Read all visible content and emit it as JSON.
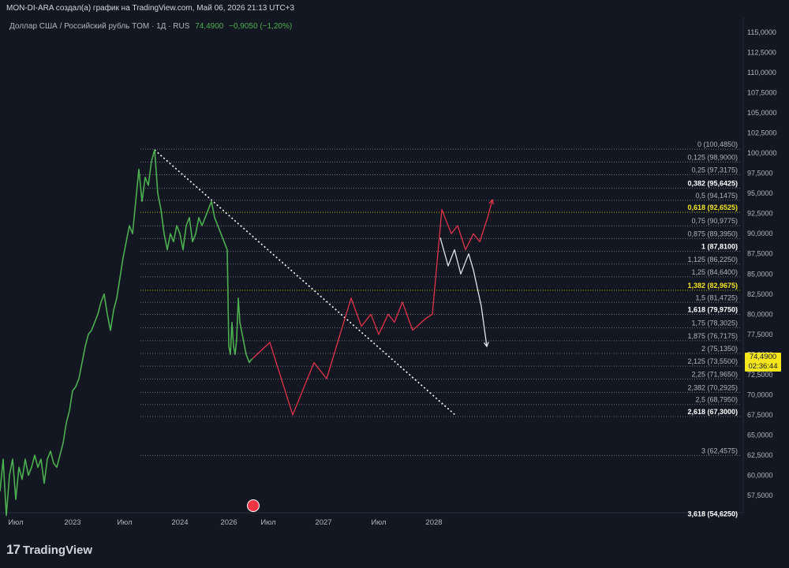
{
  "header": {
    "caption": "MON-DI-ARA создал(а) график на TradingView.com, Май 06, 2026 21:13 UTC+3"
  },
  "symbol": {
    "name": "Доллар США / Российский рубль TOM · 1Д · RUS",
    "price": "74,4900",
    "change": "−0,9050 (−1,20%)"
  },
  "price_tag": {
    "price": "74,4900",
    "timer": "02:36:44"
  },
  "footer": {
    "brand": "TradingView"
  },
  "colors": {
    "background": "#131722",
    "price_line": "#4caf50",
    "projection_red": "#e0334a",
    "projection_white": "#e0e3eb",
    "fib_line": "#787b86",
    "fib_highlight": "#f5e61c"
  },
  "icons": {
    "flag": "usa-flag-event-icon",
    "logo": "tradingview-logo-icon"
  },
  "chart_data": {
    "type": "line",
    "y_axis_ticks": [
      "115,0000",
      "112,5000",
      "110,0000",
      "107,5000",
      "105,0000",
      "102,5000",
      "100,0000",
      "97,5000",
      "95,0000",
      "92,5000",
      "90,0000",
      "87,5000",
      "85,0000",
      "82,5000",
      "80,0000",
      "77,5000",
      "75,0000",
      "72,5000",
      "70,0000",
      "67,5000",
      "65,0000",
      "62,5000",
      "60,0000",
      "57,5000"
    ],
    "x_axis_ticks": [
      "Июл",
      "2023",
      "Июл",
      "2024",
      "2026",
      "Июл",
      "2027",
      "Июл",
      "2028"
    ],
    "fib_levels": [
      {
        "label": "0 (100,4850)",
        "value": 100.485,
        "style": "normal"
      },
      {
        "label": "0,125 (98,9000)",
        "value": 98.9,
        "style": "normal"
      },
      {
        "label": "0,25 (97,3175)",
        "value": 97.3175,
        "style": "normal"
      },
      {
        "label": "0,382 (95,6425)",
        "value": 95.6425,
        "style": "bold"
      },
      {
        "label": "0,5 (94,1475)",
        "value": 94.1475,
        "style": "normal"
      },
      {
        "label": "0,618 (92,6525)",
        "value": 92.6525,
        "style": "yellow"
      },
      {
        "label": "0,75 (90,9775)",
        "value": 90.9775,
        "style": "normal"
      },
      {
        "label": "0,875 (89,3950)",
        "value": 89.395,
        "style": "normal"
      },
      {
        "label": "1 (87,8100)",
        "value": 87.81,
        "style": "bold"
      },
      {
        "label": "1,125 (86,2250)",
        "value": 86.225,
        "style": "normal"
      },
      {
        "label": "1,25 (84,6400)",
        "value": 84.64,
        "style": "normal"
      },
      {
        "label": "1,382 (82,9675)",
        "value": 82.9675,
        "style": "yellow"
      },
      {
        "label": "1,5 (81,4725)",
        "value": 81.4725,
        "style": "normal"
      },
      {
        "label": "1,618 (79,9750)",
        "value": 79.975,
        "style": "bold"
      },
      {
        "label": "1,75 (78,3025)",
        "value": 78.3025,
        "style": "normal"
      },
      {
        "label": "1,875 (76,7175)",
        "value": 76.7175,
        "style": "normal"
      },
      {
        "label": "2 (75,1350)",
        "value": 75.135,
        "style": "normal"
      },
      {
        "label": "2,125 (73,5500)",
        "value": 73.55,
        "style": "normal"
      },
      {
        "label": "2,25 (71,9650)",
        "value": 71.965,
        "style": "normal"
      },
      {
        "label": "2,382 (70,2925)",
        "value": 70.2925,
        "style": "normal"
      },
      {
        "label": "2,5 (68,7950)",
        "value": 68.795,
        "style": "normal"
      },
      {
        "label": "2,618 (67,3000)",
        "value": 67.3,
        "style": "bold"
      },
      {
        "label": "3 (62,4575)",
        "value": 62.4575,
        "style": "normal"
      },
      {
        "label": "3,618 (54,6250)",
        "value": 54.625,
        "style": "bold"
      }
    ],
    "series": [
      {
        "kind": "price",
        "points": [
          [
            0,
            58.0
          ],
          [
            4,
            62.0
          ],
          [
            8,
            55.0
          ],
          [
            12,
            60.0
          ],
          [
            16,
            62.0
          ],
          [
            20,
            57.0
          ],
          [
            24,
            61.0
          ],
          [
            28,
            59.5
          ],
          [
            32,
            62.0
          ],
          [
            36,
            60.0
          ],
          [
            40,
            61.0
          ],
          [
            44,
            62.5
          ],
          [
            48,
            61.0
          ],
          [
            52,
            62.0
          ],
          [
            56,
            59.0
          ],
          [
            60,
            62.0
          ],
          [
            64,
            63.0
          ],
          [
            68,
            61.5
          ],
          [
            72,
            61.0
          ],
          [
            76,
            62.5
          ],
          [
            80,
            64.0
          ],
          [
            84,
            66.5
          ],
          [
            88,
            68.0
          ],
          [
            92,
            70.5
          ],
          [
            96,
            71.0
          ],
          [
            100,
            72.0
          ],
          [
            104,
            74.0
          ],
          [
            108,
            76.0
          ],
          [
            112,
            77.5
          ],
          [
            116,
            78.0
          ],
          [
            120,
            79.0
          ],
          [
            124,
            80.0
          ],
          [
            128,
            81.5
          ],
          [
            132,
            82.5
          ],
          [
            136,
            80.0
          ],
          [
            140,
            78.0
          ],
          [
            144,
            80.5
          ],
          [
            148,
            82.0
          ],
          [
            152,
            84.5
          ],
          [
            156,
            87.0
          ],
          [
            160,
            89.0
          ],
          [
            164,
            91.0
          ],
          [
            168,
            90.0
          ],
          [
            172,
            94.0
          ],
          [
            176,
            98.0
          ],
          [
            180,
            94.0
          ],
          [
            184,
            97.0
          ],
          [
            188,
            96.0
          ],
          [
            192,
            99.0
          ],
          [
            196,
            100.4
          ],
          [
            200,
            95.0
          ],
          [
            204,
            93.0
          ],
          [
            208,
            90.0
          ],
          [
            212,
            88.0
          ],
          [
            216,
            90.0
          ],
          [
            220,
            89.0
          ],
          [
            224,
            91.0
          ],
          [
            228,
            90.0
          ],
          [
            232,
            88.0
          ],
          [
            236,
            91.0
          ],
          [
            240,
            92.0
          ],
          [
            244,
            89.0
          ],
          [
            248,
            90.0
          ],
          [
            252,
            92.0
          ],
          [
            256,
            91.0
          ],
          [
            260,
            92.0
          ],
          [
            264,
            93.0
          ],
          [
            268,
            94.0
          ],
          [
            272,
            92.0
          ],
          [
            276,
            91.0
          ],
          [
            280,
            90.0
          ],
          [
            284,
            89.0
          ],
          [
            288,
            88.0
          ],
          [
            290,
            76.0
          ],
          [
            292,
            75.0
          ],
          [
            294,
            79.0
          ],
          [
            296,
            76.0
          ],
          [
            298,
            75.0
          ],
          [
            300,
            77.0
          ],
          [
            302,
            82.0
          ],
          [
            304,
            79.0
          ],
          [
            306,
            78.0
          ],
          [
            308,
            77.0
          ],
          [
            310,
            76.0
          ],
          [
            312,
            75.0
          ],
          [
            314,
            74.5
          ],
          [
            316,
            74.0
          ],
          [
            318,
            74.3
          ],
          [
            320,
            74.49
          ]
        ]
      },
      {
        "kind": "projection_red",
        "points": [
          [
            320,
            74.49
          ],
          [
            342,
            76.5
          ],
          [
            371,
            67.5
          ],
          [
            398,
            74.0
          ],
          [
            414,
            72.0
          ],
          [
            445,
            82.0
          ],
          [
            458,
            78.5
          ],
          [
            470,
            80.0
          ],
          [
            480,
            77.5
          ],
          [
            492,
            80.0
          ],
          [
            500,
            79.0
          ],
          [
            510,
            81.5
          ],
          [
            523,
            78.0
          ],
          [
            540,
            79.5
          ],
          [
            548,
            80.0
          ],
          [
            560,
            93.0
          ],
          [
            572,
            90.0
          ],
          [
            580,
            91.0
          ],
          [
            590,
            88.0
          ],
          [
            600,
            90.0
          ],
          [
            608,
            89.0
          ],
          [
            618,
            92.0
          ],
          [
            624,
            94.2
          ]
        ]
      },
      {
        "kind": "projection_white",
        "points": [
          [
            558,
            89.5
          ],
          [
            568,
            86.0
          ],
          [
            576,
            88.0
          ],
          [
            584,
            85.0
          ],
          [
            594,
            87.5
          ],
          [
            600,
            85.5
          ],
          [
            610,
            81.0
          ],
          [
            617,
            76.0
          ]
        ]
      }
    ],
    "trendline": {
      "from": [
        196,
        100.4
      ],
      "to": [
        578,
        67.4
      ]
    }
  }
}
